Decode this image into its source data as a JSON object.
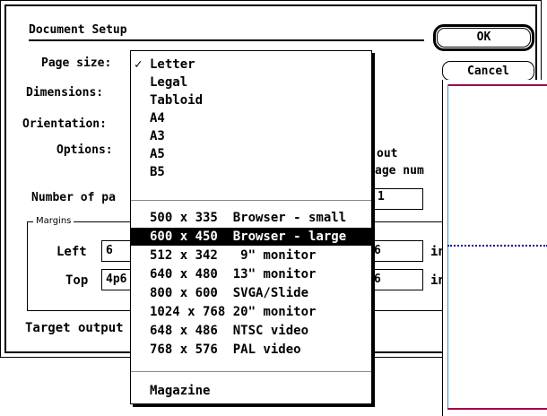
{
  "dialog": {
    "title": "Document Setup",
    "ok_label": "OK",
    "cancel_label": "Cancel"
  },
  "labels": {
    "page_size": "Page size:",
    "dimensions": "Dimensions:",
    "orientation": "Orientation:",
    "options": "Options:",
    "number_of": "Number of pa",
    "margins": "Margins",
    "left": "Left",
    "top": "Top",
    "target_output": "Target output",
    "options_trail_1": "out",
    "options_trail_2": "age num",
    "unit_1": "in",
    "unit_2": "in"
  },
  "fields": {
    "number_value": "1",
    "left_value": "6",
    "top_value": "4p6",
    "right_partial_1": "6",
    "right_partial_2": "6"
  },
  "menu": {
    "checked_mark": "✓",
    "items": [
      "Letter",
      "Legal",
      "Tabloid",
      "A4",
      "A3",
      "A5",
      "B5",
      "500 x 335  Browser - small",
      "600 x 450  Browser - large",
      "512 x 342   9\" monitor",
      "640 x 480  13\" monitor",
      "800 x 600  SVGA/Slide",
      "1024 x 768 20\" monitor",
      "648 x 486  NTSC video",
      "768 x 576  PAL video",
      "Magazine"
    ],
    "checked_index": 0,
    "selected_index": 8
  },
  "colors": {
    "preview_border_top": "#a0004a",
    "preview_border_left": "#3399cc",
    "guide_line": "#000099"
  }
}
